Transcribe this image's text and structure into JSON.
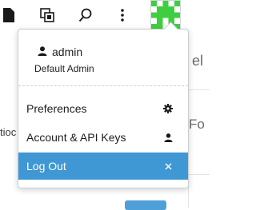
{
  "topbar": {
    "icons": [
      "file-icon",
      "duplicate-icon",
      "search-icon",
      "more-vertical-icon"
    ]
  },
  "background": {
    "fragments": [
      "el",
      "Fo",
      "tioc"
    ]
  },
  "user": {
    "name": "admin",
    "role": "Default Admin"
  },
  "menu": {
    "items": [
      {
        "label": "Preferences",
        "icon": "gear-icon"
      },
      {
        "label": "Account & API Keys",
        "icon": "user-icon"
      },
      {
        "label": "Log Out",
        "icon": "close-icon",
        "active": true
      }
    ]
  },
  "colors": {
    "accent": "#3f97d3",
    "avatar_green": "#3fce3f"
  }
}
